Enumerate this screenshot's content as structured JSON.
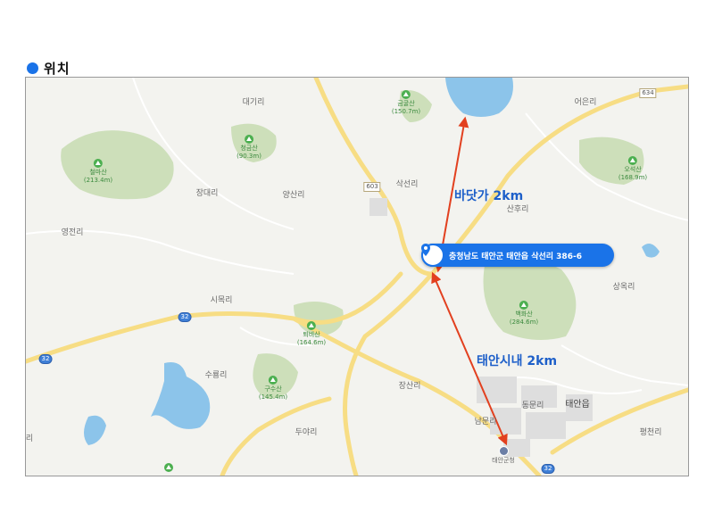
{
  "section": {
    "title": "위치"
  },
  "map": {
    "address": "충청남도 태안군 태안읍 삭선리 386-6",
    "overlays": {
      "seaside": "바닷가 2km",
      "downtown": "태안시내 2km"
    },
    "places": {
      "daegiri": "대기리",
      "eoeunri": "어은리",
      "sakseonri": "삭선리",
      "sanhuri": "산후리",
      "jangdaeri": "장대리",
      "yangsanri": "양산리",
      "yeongjeonri": "영전리",
      "simokri": "시목리",
      "sangokri": "상옥리",
      "suryongri": "수룡리",
      "jangsanri": "장산리",
      "duyari": "두야리",
      "dongmunri": "동문리",
      "nammunri": "남문리",
      "pyeongcheonri": "평천리",
      "ri_edge": "리"
    },
    "town": {
      "taean": "태안읍"
    },
    "office": "태안군청",
    "mountains": [
      {
        "name": "금굴산",
        "elev": "(150.7m)"
      },
      {
        "name": "청금산",
        "elev": "(90.3m)"
      },
      {
        "name": "철마산",
        "elev": "(213.4m)"
      },
      {
        "name": "오석산",
        "elev": "(168.9m)"
      },
      {
        "name": "백화산",
        "elev": "(284.6m)"
      },
      {
        "name": "퇴비산",
        "elev": "(164.6m)"
      },
      {
        "name": "구수산",
        "elev": "(145.4m)"
      },
      {
        "name": "",
        "elev": ""
      }
    ],
    "roads": {
      "r634": "634",
      "r603": "603",
      "r32a": "32",
      "r32b": "32",
      "r32c": "32"
    },
    "colors": {
      "accent": "#1a73e8",
      "arrow": "#e2401f",
      "water": "#8cc4ea",
      "road": "#f7dd84"
    }
  }
}
